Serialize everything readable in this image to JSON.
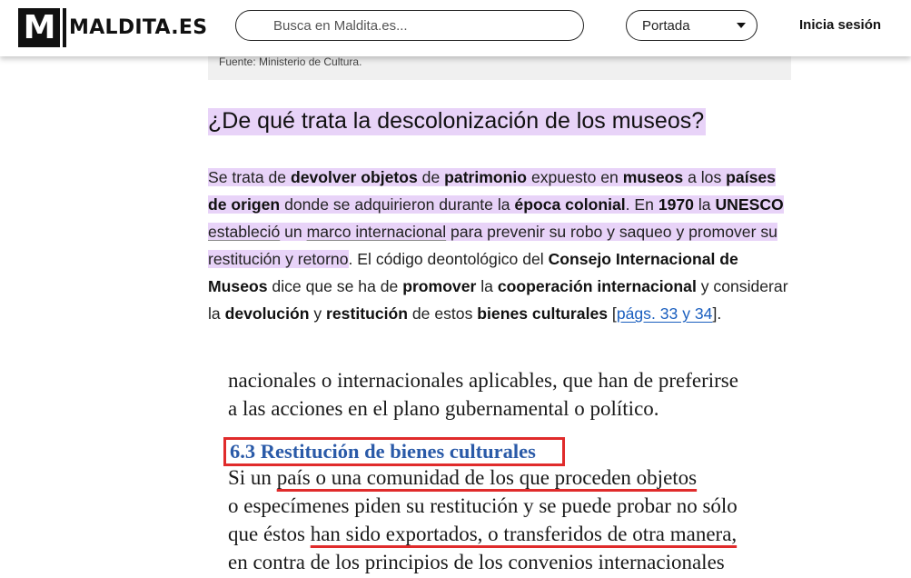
{
  "header": {
    "logo_mark": "M",
    "logo_text": "MALDITA.ES",
    "search_placeholder": "Busca en Maldita.es...",
    "section_select": "Portada",
    "login_label": "Inicia sesión"
  },
  "source": {
    "text": "Fuente: Ministerio de Cultura."
  },
  "article": {
    "heading": "¿De qué trata la descolonización de los museos?",
    "para": {
      "t1": "Se trata de ",
      "b1": "devolver objetos",
      "t2": " de ",
      "b2": "patrimonio",
      "t3": " expuesto en ",
      "b3": "museos",
      "t4": " a los ",
      "b4": "países de origen",
      "t5": " donde se adquirieron durante la ",
      "b5": "época colonial",
      "t6": ". En ",
      "b6": "1970",
      "t7": " la ",
      "b7": "UNESCO",
      "t8": " ",
      "u1": "estableció",
      "t9": " un ",
      "u2": "marco internacional",
      "t10": " para prevenir su robo y saqueo y promover su restitución y retorno",
      "t11": ". El código deontológico del ",
      "b8": "Consejo Internacional de Museos",
      "t12": " dice que se ha de ",
      "b9": "promover",
      "t13": " la ",
      "b10": "cooperación internacional",
      "t14": " y considerar la ",
      "b11": "devolución",
      "t15": " y ",
      "b12": "restitución",
      "t16": " de estos ",
      "b13": "bienes culturales",
      "t17": " [",
      "link": "págs. 33 y 34",
      "t18": "]."
    }
  },
  "document_excerpt": {
    "line1": "nacionales o internacionales aplicables, que han de preferirse",
    "line2": "a las acciones en el plano gubernamental o político.",
    "title": "6.3 Restitución de bienes culturales",
    "line3_a": "Si un ",
    "line3_u": "país o una comunidad de los que proceden objetos",
    "line4": "o especímenes piden su restitución y se puede probar no sólo",
    "line5_a": "que éstos ",
    "line5_u": "han sido exportados, o transferidos de otra manera,",
    "line6": "en contra de los principios de los convenios internacionales"
  },
  "colors": {
    "highlight": "#e8d3f8",
    "link": "#1b5fbf",
    "annotation_red": "#e02b2b",
    "doc_title_blue": "#2a5aa8"
  }
}
